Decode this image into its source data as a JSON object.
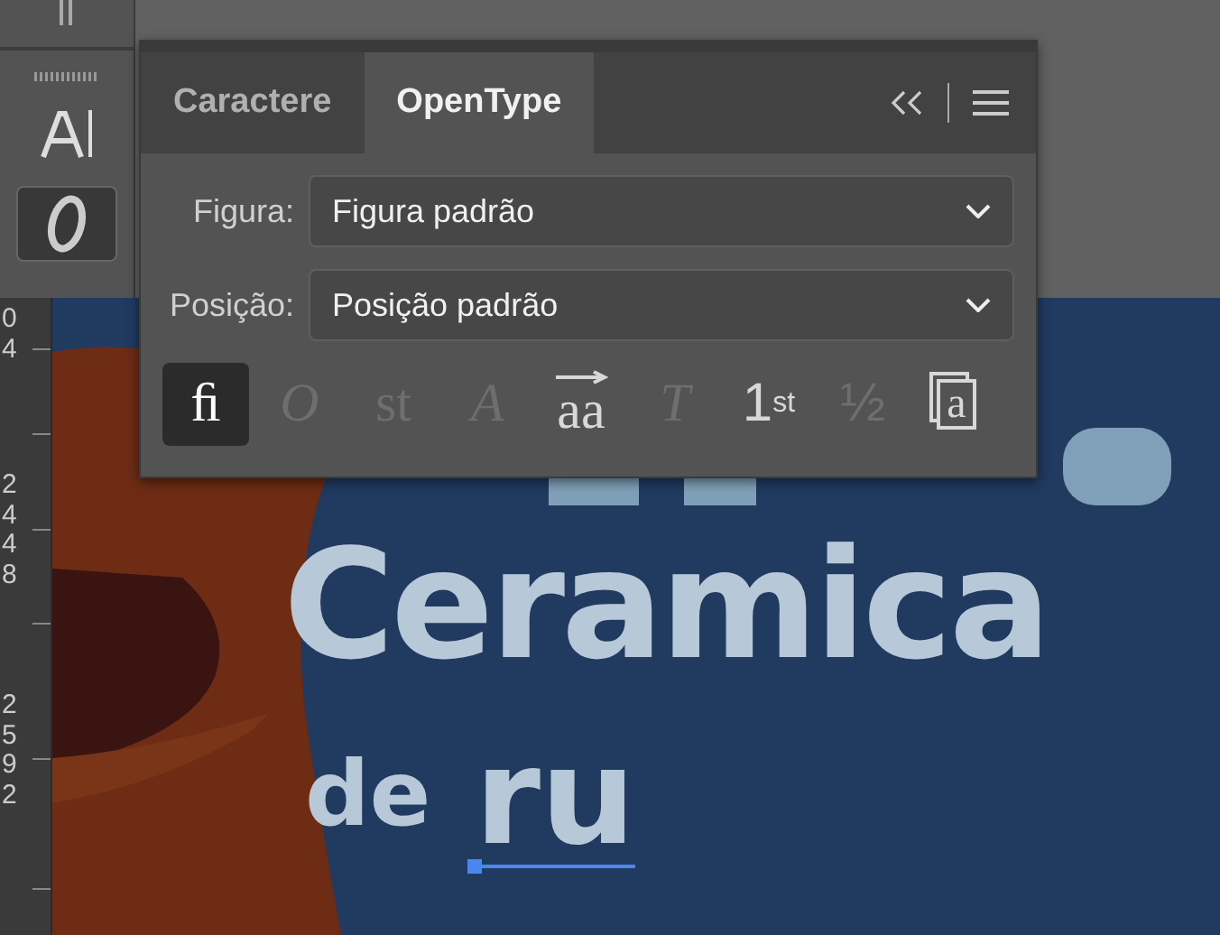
{
  "toolbar": {
    "tools": [
      {
        "kind": "type",
        "selected": false
      },
      {
        "kind": "opentype",
        "selected": true
      }
    ]
  },
  "ruler": {
    "labels": [
      "04",
      "2448",
      "2592"
    ]
  },
  "panel": {
    "tabs": [
      {
        "label": "Caractere",
        "selected": false
      },
      {
        "label": "OpenType",
        "selected": true
      }
    ],
    "fields": [
      {
        "label": "Figura:",
        "value": "Figura padrão"
      },
      {
        "label": "Posição:",
        "value": "Posição padrão"
      }
    ],
    "features": [
      {
        "label": "ﬁ",
        "kind": "roman",
        "selected": true,
        "disabled": false
      },
      {
        "label": "O",
        "kind": "italic",
        "selected": false,
        "disabled": true
      },
      {
        "label": "st",
        "kind": "roman",
        "selected": false,
        "disabled": true
      },
      {
        "label": "A",
        "kind": "italic",
        "selected": false,
        "disabled": true
      },
      {
        "label": "aa",
        "kind": "arrow",
        "selected": false,
        "disabled": false
      },
      {
        "label": "T",
        "kind": "italic",
        "selected": false,
        "disabled": true
      },
      {
        "label": "1$^{st}$",
        "kind": "sans",
        "selected": false,
        "disabled": false
      },
      {
        "label": "½",
        "kind": "sans",
        "selected": false,
        "disabled": true
      },
      {
        "label": "a",
        "kind": "boxed",
        "selected": false,
        "disabled": false
      }
    ]
  },
  "artwork": {
    "lines": [
      {
        "text": "Ceramica",
        "kind": "title"
      },
      {
        "text": "de",
        "kind": "small"
      },
      {
        "text": "ru",
        "kind": "selected"
      }
    ]
  }
}
